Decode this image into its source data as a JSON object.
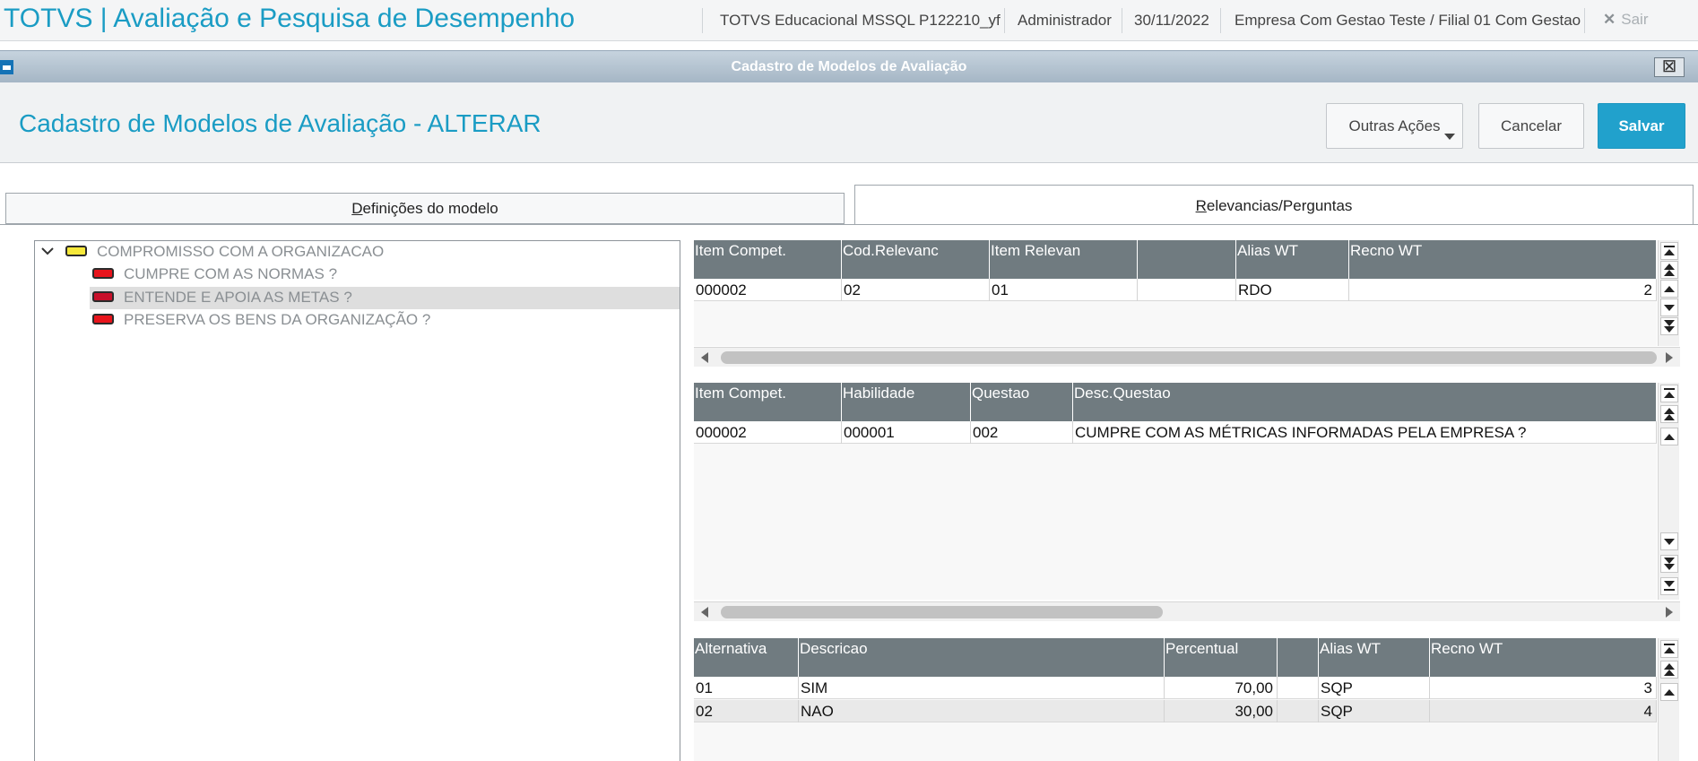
{
  "header": {
    "app_title": "TOTVS | Avaliação e Pesquisa de Desempenho",
    "environment": "TOTVS Educacional MSSQL P122210_yf",
    "user": "Administrador",
    "date": "30/11/2022",
    "company": "Empresa Com Gestao Teste / Filial 01 Com Gestao",
    "exit_label": "Sair"
  },
  "dialog": {
    "title": "Cadastro de Modelos de Avaliação",
    "close_glyph": "⊠"
  },
  "page": {
    "title": "Cadastro de Modelos de Avaliação - ALTERAR",
    "buttons": {
      "outras": "Outras Ações",
      "cancelar": "Cancelar",
      "salvar": "Salvar"
    }
  },
  "tabs": {
    "definicoes": {
      "first": "D",
      "rest": "efinições do modelo"
    },
    "relevancias": {
      "first": "R",
      "rest": "elevancias/Perguntas"
    }
  },
  "tree": {
    "root": {
      "label": "COMPROMISSO COM A ORGANIZACAO",
      "color": "#f5e83a"
    },
    "items": [
      {
        "label": "CUMPRE COM AS NORMAS ?",
        "color": "#e8141c"
      },
      {
        "label": "ENTENDE E APOIA AS METAS ?",
        "color": "#c8102a"
      },
      {
        "label": "PRESERVA OS BENS DA ORGANIZAÇÃO ?",
        "color": "#e8141c"
      }
    ]
  },
  "grid_relevancias": {
    "columns": [
      "Item Compet.",
      "Cod.Relevanc",
      "Item Relevan",
      "",
      "Alias WT",
      "Recno WT"
    ],
    "rows": [
      [
        "000002",
        "02",
        "01",
        "",
        "RDO",
        "2"
      ]
    ]
  },
  "grid_questoes": {
    "columns": [
      "Item Compet.",
      "Habilidade",
      "Questao",
      "Desc.Questao"
    ],
    "rows": [
      [
        "000002",
        "000001",
        "002",
        "CUMPRE COM AS MÉTRICAS INFORMADAS PELA EMPRESA ?"
      ]
    ]
  },
  "grid_alternativas": {
    "columns": [
      "Alternativa",
      "Descricao",
      "Percentual",
      "",
      "Alias WT",
      "Recno WT"
    ],
    "rows": [
      [
        "01",
        "SIM",
        "70,00",
        "",
        "SQP",
        "3"
      ],
      [
        "02",
        "NAO",
        "30,00",
        "",
        "SQP",
        "4"
      ]
    ]
  }
}
